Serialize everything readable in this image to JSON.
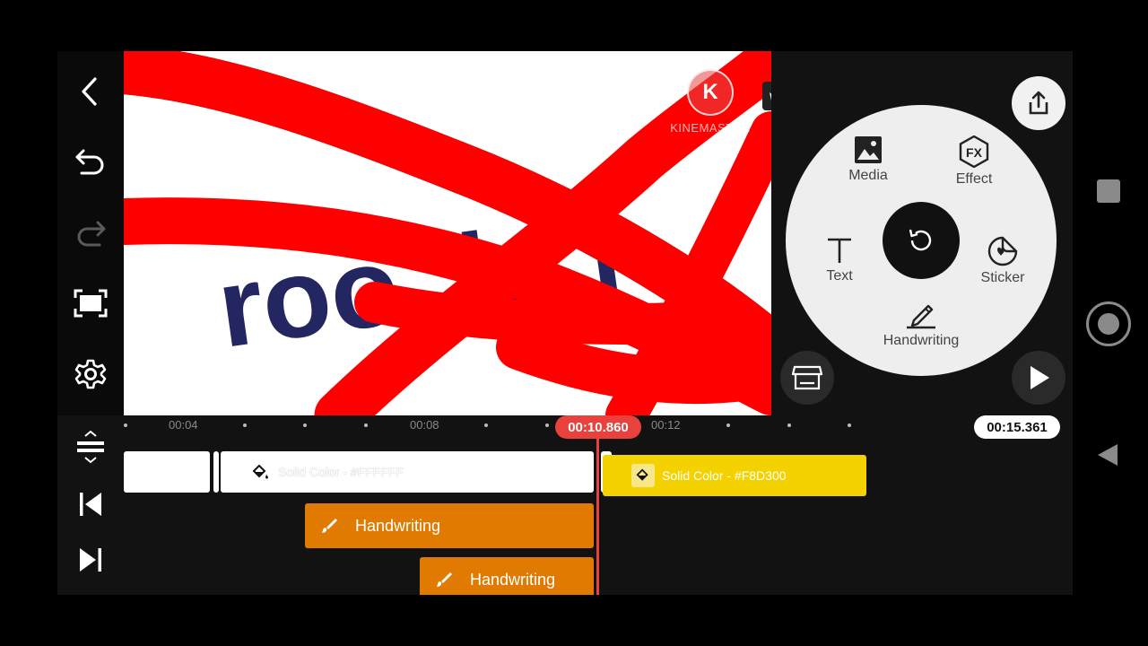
{
  "left_toolbar": {
    "back": "back-arrow",
    "undo": "undo-arrow",
    "redo": "redo-arrow",
    "fullscreen": "fullscreen-frame",
    "settings": "gear"
  },
  "preview": {
    "watermark_text": "KINEMASTER",
    "watermark_logo_letter": "K",
    "partial_text": "roo..b..r"
  },
  "circle_menu": {
    "media_label": "Media",
    "effect_label": "Effect",
    "text_label": "Text",
    "sticker_label": "Sticker",
    "handwriting_label": "Handwriting"
  },
  "timeline": {
    "current_time": "00:10.860",
    "total_time": "00:15.361",
    "ticks": [
      "00:04",
      "00:08",
      "00:12"
    ],
    "clips": {
      "white_label": "Solid Color - #FFFFFF",
      "yellow_label": "Solid Color - #F8D300",
      "handwriting1_label": "Handwriting",
      "handwriting2_label": "Handwriting"
    }
  },
  "colors": {
    "accent_red": "#e9413b",
    "clip_yellow": "#f4d100",
    "clip_orange": "#e17a00",
    "scribble_red": "#ff0000",
    "text_navy": "#232660"
  }
}
